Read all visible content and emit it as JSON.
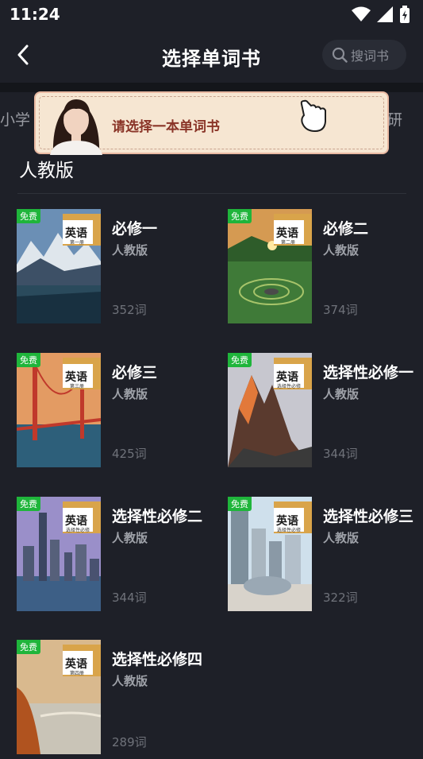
{
  "status": {
    "time": "11:24"
  },
  "nav": {
    "title": "选择单词书",
    "search_placeholder": "搜词书"
  },
  "tabs": {
    "left_partial": "小学",
    "right_partial": "研"
  },
  "banner": {
    "text": "请选择一本单词书"
  },
  "section": {
    "title": "人教版"
  },
  "books": [
    {
      "title": "必修一",
      "publisher": "人教版",
      "count": "352词",
      "badge": "免费",
      "cover_title": "英语",
      "cover_sub": "第一册"
    },
    {
      "title": "必修二",
      "publisher": "人教版",
      "count": "374词",
      "badge": "免费",
      "cover_title": "英语",
      "cover_sub": "第二册"
    },
    {
      "title": "必修三",
      "publisher": "人教版",
      "count": "425词",
      "badge": "免费",
      "cover_title": "英语",
      "cover_sub": "第三册"
    },
    {
      "title": "选择性必修一",
      "publisher": "人教版",
      "count": "344词",
      "badge": "免费",
      "cover_title": "英语",
      "cover_sub": "选择性必修"
    },
    {
      "title": "选择性必修二",
      "publisher": "人教版",
      "count": "344词",
      "badge": "免费",
      "cover_title": "英语",
      "cover_sub": "选择性必修"
    },
    {
      "title": "选择性必修三",
      "publisher": "人教版",
      "count": "322词",
      "badge": "免费",
      "cover_title": "英语",
      "cover_sub": "选择性必修"
    },
    {
      "title": "选择性必修四",
      "publisher": "人教版",
      "count": "289词",
      "badge": "免费",
      "cover_title": "英语",
      "cover_sub": "第四册"
    }
  ],
  "colors": {
    "background": "#1e2028",
    "badge": "#1fb53b",
    "banner_bg": "#f6e6d2",
    "banner_text": "#8a3528"
  }
}
